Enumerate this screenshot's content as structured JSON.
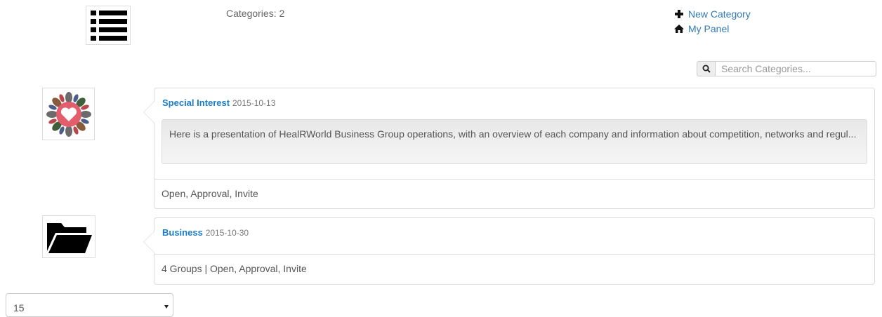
{
  "header": {
    "icon": "list-icon",
    "count_label": "Categories: 2"
  },
  "actions": {
    "new_category": {
      "label": "New Category",
      "icon": "plus-icon"
    },
    "my_panel": {
      "label": "My Panel",
      "icon": "home-icon"
    }
  },
  "search": {
    "icon": "search-icon",
    "placeholder": "Search Categories..."
  },
  "categories": [
    {
      "title": "Special Interest",
      "date": "2015-10-13",
      "thumbnail": "heart-flower-image",
      "description": "Here is a presentation of HealRWorld Business Group operations, with an overview of each company and information about competition, networks and regul...",
      "footer": "Open, Approval, Invite"
    },
    {
      "title": "Business",
      "date": "2015-10-30",
      "thumbnail": "folder-open-icon",
      "footer": "4 Groups | Open, Approval, Invite"
    }
  ],
  "pagination": {
    "per_page": "15"
  },
  "colors": {
    "link": "#337ab7",
    "title": "#1b7dc9",
    "border": "#dddddd"
  }
}
